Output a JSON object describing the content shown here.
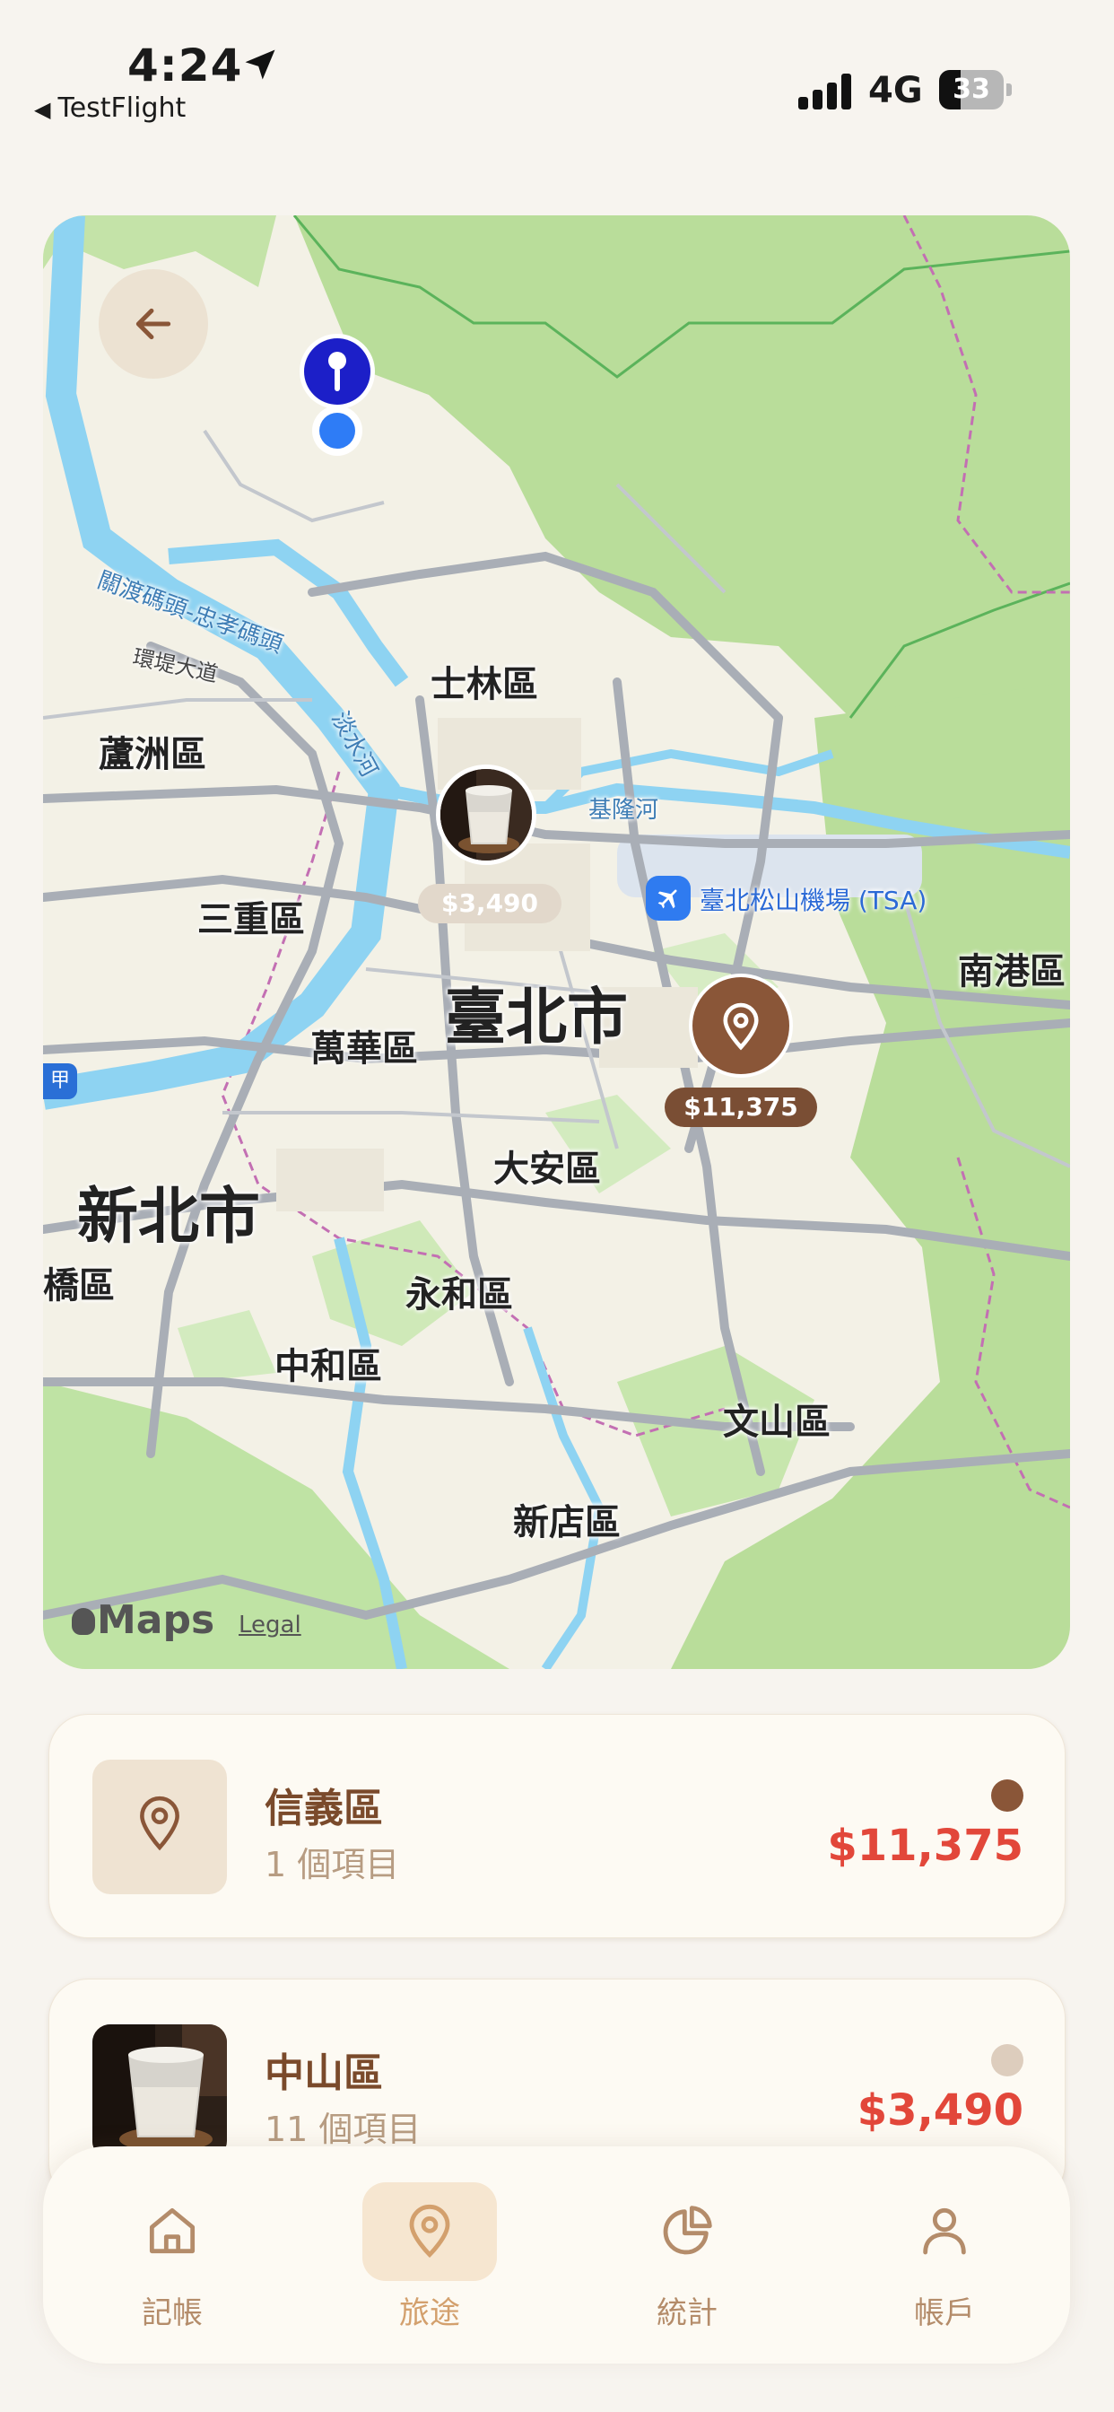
{
  "status_bar": {
    "time": "4:24",
    "back_app": "TestFlight",
    "network": "4G",
    "battery": "33"
  },
  "map": {
    "districts": {
      "shilin": "士林區",
      "luzhou": "蘆洲區",
      "sanchong": "三重區",
      "wanhua": "萬華區",
      "daan": "大安區",
      "yonghe": "永和區",
      "zhonghe": "中和區",
      "wenshan": "文山區",
      "xindian": "新店區",
      "nangang": "南港區",
      "banqiao": "板橋區"
    },
    "cities": {
      "taipei": "臺北市",
      "new_taipei": "新北市"
    },
    "rivers": {
      "keelung": "基隆河",
      "tamsui": "淡水河"
    },
    "roads": {
      "ring": "環堤大道",
      "bikeway": "關渡碼頭-忠孝碼頭"
    },
    "airport": "臺北松山機場 (TSA)",
    "route_badge": "甲",
    "pins": [
      {
        "amount": "$3,490"
      },
      {
        "amount": "$11,375"
      }
    ],
    "attribution": {
      "brand": "Maps",
      "legal": "Legal"
    },
    "colors": {
      "land": "#f3f1e6",
      "park": "#bfe3a1",
      "water": "#8ed3f2",
      "road": "#a9aeb6",
      "pin": "#8a5638"
    }
  },
  "locations": [
    {
      "name": "信義區",
      "count": "1 個項目",
      "amount": "$11,375",
      "dot_color": "#8a5638"
    },
    {
      "name": "中山區",
      "count": "11 個項目",
      "amount": "$3,490",
      "dot_color": "#ddcdbd"
    }
  ],
  "tabs": [
    {
      "label": "記帳",
      "icon": "home-icon"
    },
    {
      "label": "旅途",
      "icon": "map-pin-icon",
      "active": true
    },
    {
      "label": "統計",
      "icon": "pie-chart-icon"
    },
    {
      "label": "帳戶",
      "icon": "person-icon"
    }
  ],
  "colors": {
    "accent": "#d3a06d",
    "amount": "#e2473a",
    "title": "#7a4a2b"
  }
}
